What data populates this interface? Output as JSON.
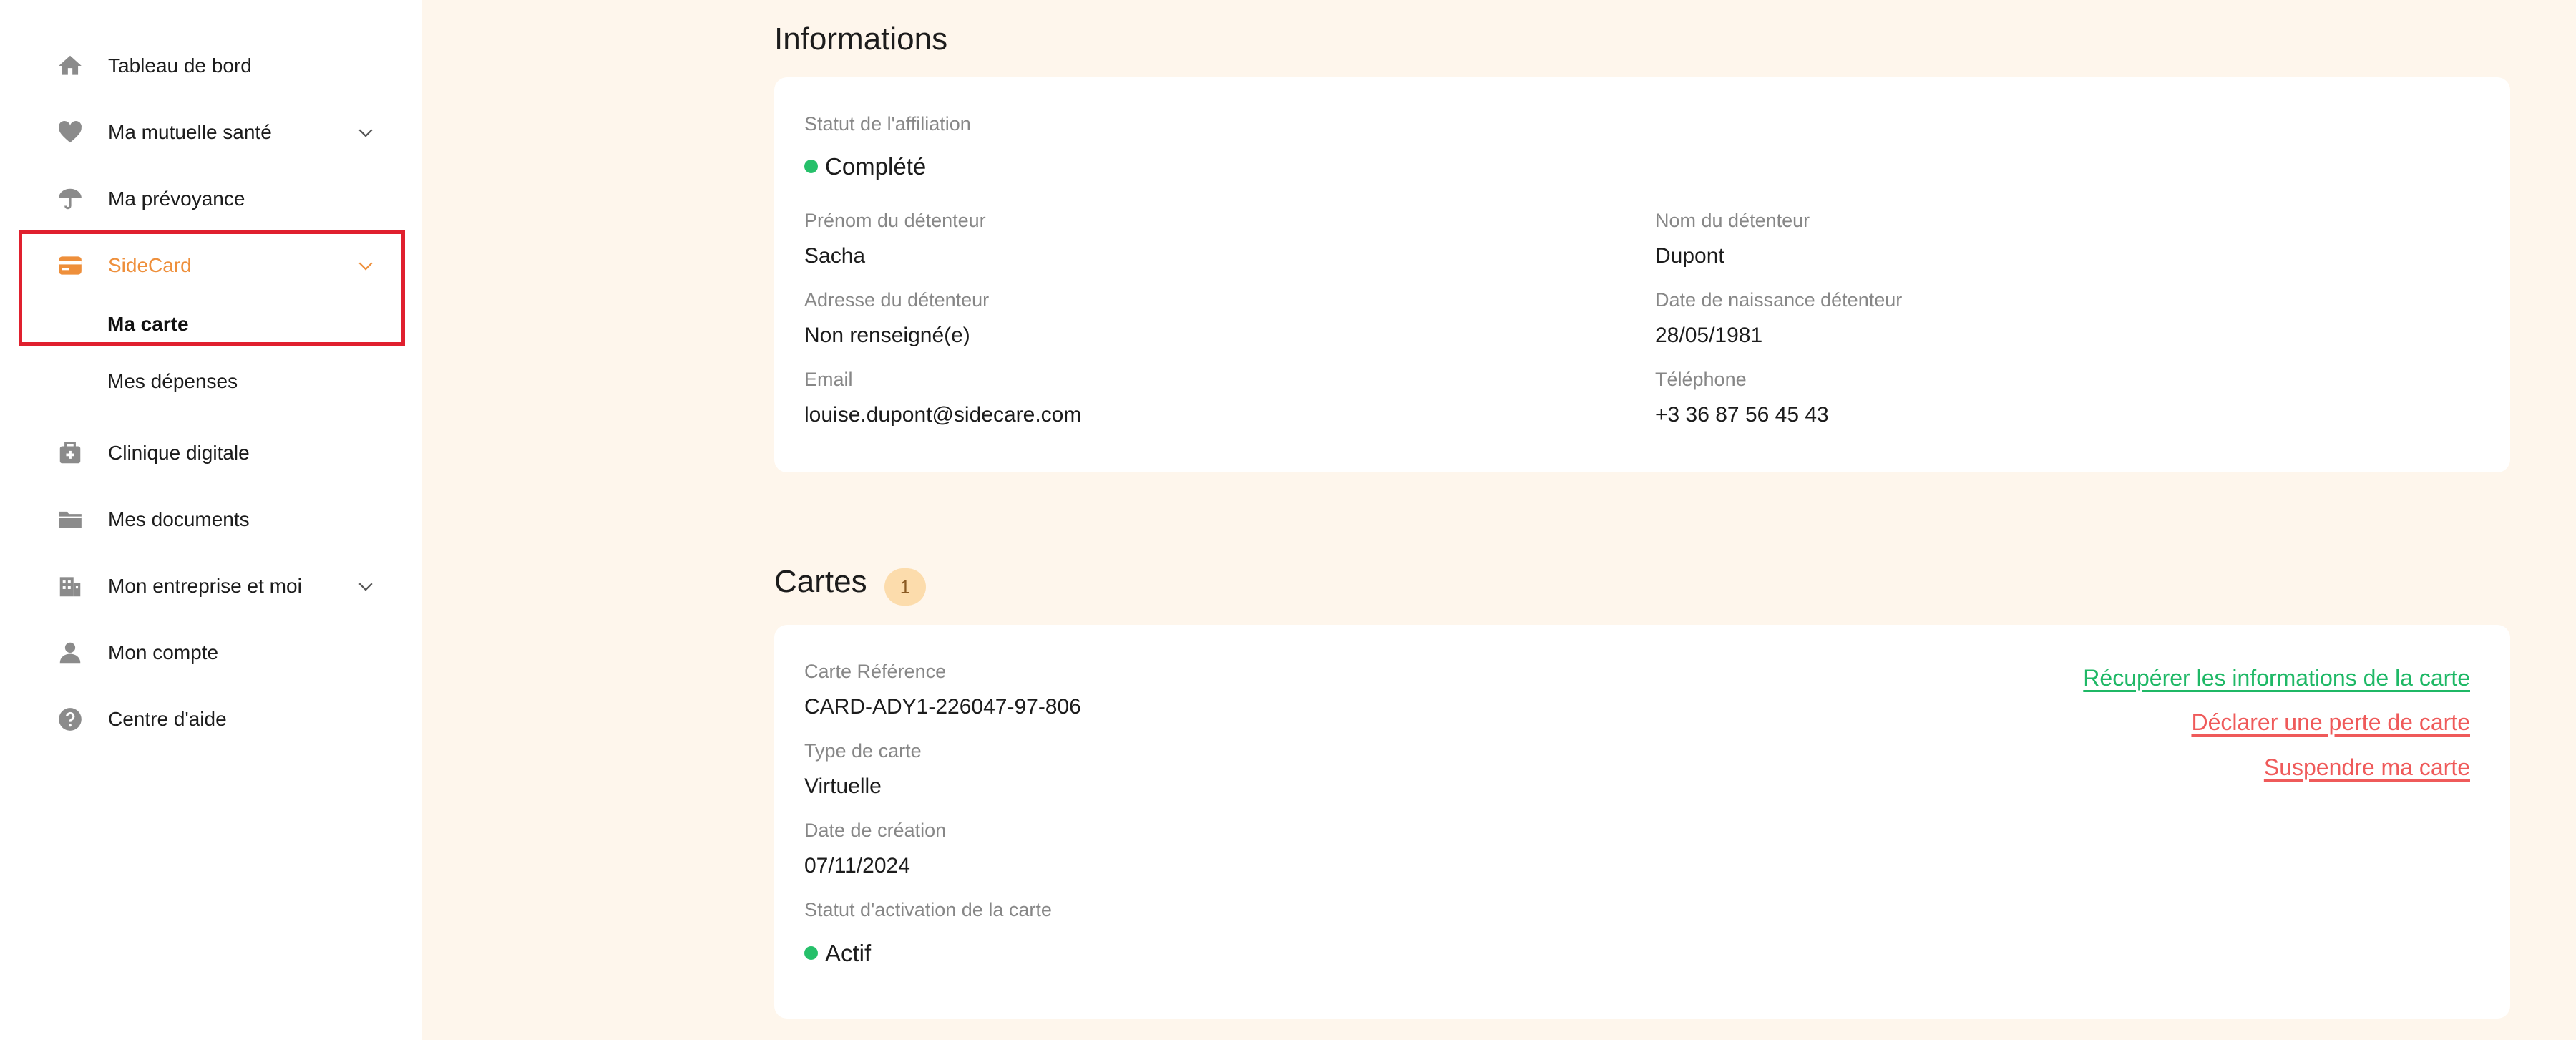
{
  "sidebar": {
    "items": [
      {
        "label": "Tableau de bord",
        "icon": "home-icon"
      },
      {
        "label": "Ma mutuelle santé",
        "icon": "heart-icon"
      },
      {
        "label": "Ma prévoyance",
        "icon": "umbrella-icon"
      },
      {
        "label": "SideCard",
        "icon": "credit-card-icon"
      },
      {
        "label": "Clinique digitale",
        "icon": "medical-kit-icon"
      },
      {
        "label": "Mes documents",
        "icon": "folder-icon"
      },
      {
        "label": "Mon entreprise et moi",
        "icon": "building-icon"
      },
      {
        "label": "Mon compte",
        "icon": "user-icon"
      },
      {
        "label": "Centre d'aide",
        "icon": "help-icon"
      }
    ],
    "sidecard_sub": [
      {
        "label": "Ma carte"
      },
      {
        "label": "Mes dépenses"
      }
    ]
  },
  "colors": {
    "accent": "#ee8f3b",
    "success": "#26c06a",
    "danger": "#ef5a5a",
    "highlight": "#e0202e",
    "background": "#fef6ec"
  },
  "informations": {
    "title": "Informations",
    "affiliation_label": "Statut de l'affiliation",
    "affiliation_value": "Complété",
    "first_name_label": "Prénom du détenteur",
    "first_name_value": "Sacha",
    "last_name_label": "Nom du détenteur",
    "last_name_value": "Dupont",
    "address_label": "Adresse du détenteur",
    "address_value": "Non renseigné(e)",
    "birthdate_label": "Date de naissance détenteur",
    "birthdate_value": "28/05/1981",
    "email_label": "Email",
    "email_value": "louise.dupont@sidecare.com",
    "phone_label": "Téléphone",
    "phone_value": "+3 36 87 56 45 43"
  },
  "cartes": {
    "title": "Cartes",
    "count": "1",
    "reference_label": "Carte Référence",
    "reference_value": "CARD-ADY1-226047-97-806",
    "type_label": "Type de carte",
    "type_value": "Virtuelle",
    "creation_label": "Date de création",
    "creation_value": "07/11/2024",
    "activation_label": "Statut d'activation de la carte",
    "activation_value": "Actif",
    "actions": {
      "retrieve": "Récupérer les informations de la carte",
      "declare_loss": "Déclarer une perte de carte",
      "suspend": "Suspendre ma carte"
    }
  }
}
